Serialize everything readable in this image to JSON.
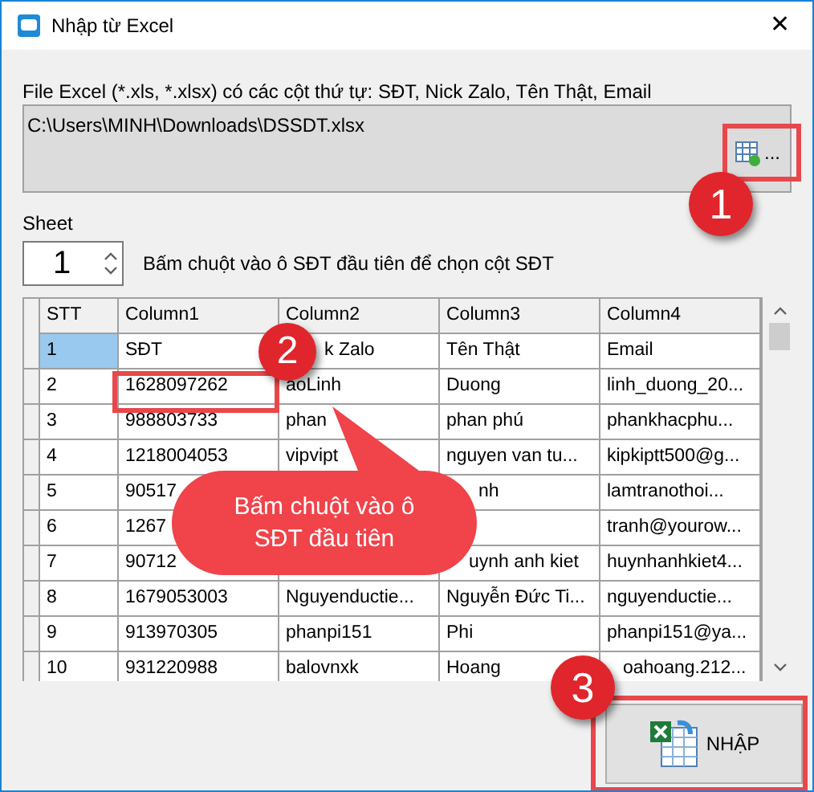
{
  "window": {
    "title": "Nhập từ Excel",
    "close": "✕"
  },
  "file": {
    "label": "File Excel (*.xls, *.xlsx) có các cột thứ tự: SĐT, Nick Zalo, Tên Thật, Email",
    "value": "C:\\Users\\MINH\\Downloads\\DSSDT.xlsx",
    "browse": "..."
  },
  "sheet": {
    "label": "Sheet",
    "value": "1",
    "hint": "Bấm chuột vào ô SĐT đầu tiên để chọn cột SĐT"
  },
  "table": {
    "columns": [
      "STT",
      "Column1",
      "Column2",
      "Column3",
      "Column4"
    ],
    "rows": [
      {
        "selected": true,
        "cells": [
          "1",
          "SĐT",
          "k Zalo",
          "Tên Thật",
          "Email"
        ]
      },
      {
        "selected": false,
        "cells": [
          "2",
          "1628097262",
          "aoLinh",
          "Duong",
          "linh_duong_20..."
        ]
      },
      {
        "selected": false,
        "cells": [
          "3",
          "988803733",
          "phan",
          "phan phú",
          "phankhacphu..."
        ]
      },
      {
        "selected": false,
        "cells": [
          "4",
          "1218004053",
          "vipvipt",
          "nguyen van tu...",
          "kipkiptt500@g..."
        ]
      },
      {
        "selected": false,
        "cells": [
          "5",
          "90517",
          "",
          "nh",
          "lamtranothoi..."
        ]
      },
      {
        "selected": false,
        "cells": [
          "6",
          "1267",
          "",
          "",
          "tranh@yourow..."
        ]
      },
      {
        "selected": false,
        "cells": [
          "7",
          "90712",
          "",
          "uynh anh kiet",
          "huynhanhkiet4..."
        ]
      },
      {
        "selected": false,
        "cells": [
          "8",
          "1679053003",
          "Nguyenductie...",
          "Nguyễn Đức Ti...",
          "nguyenductie..."
        ]
      },
      {
        "selected": false,
        "cells": [
          "9",
          "913970305",
          "phanpi151",
          "Phi",
          "phanpi151@ya..."
        ]
      },
      {
        "selected": false,
        "cells": [
          "10",
          "931220988",
          "balovnxk",
          "Hoang",
          "oahoang.212..."
        ]
      }
    ]
  },
  "import_button": "NHẬP",
  "callouts": [
    {
      "number": "1"
    },
    {
      "number": "2",
      "text": "Bấm chuột vào ô SĐT đầu tiên"
    },
    {
      "number": "3"
    }
  ]
}
